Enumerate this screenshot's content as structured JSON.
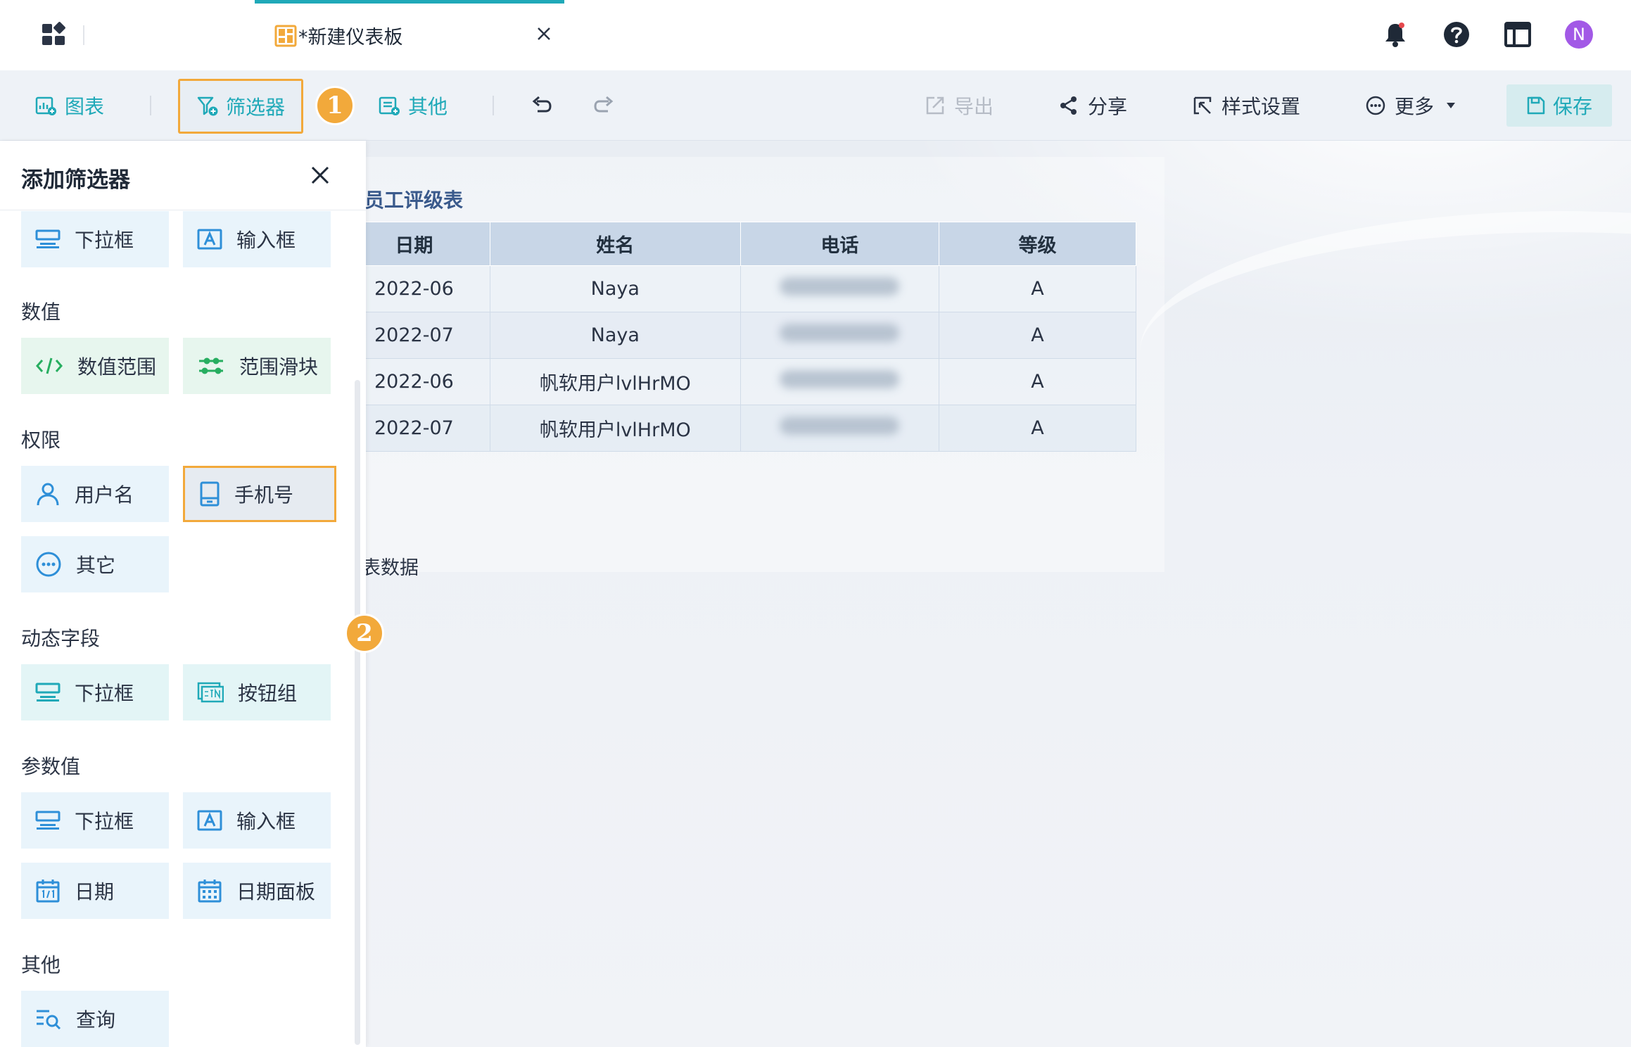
{
  "tab": {
    "title": "*新建仪表板"
  },
  "toolbar": {
    "chart_label": "图表",
    "filter_label": "筛选器",
    "other_label": "其他",
    "export_label": "导出",
    "share_label": "分享",
    "style_label": "样式设置",
    "more_label": "更多",
    "save_label": "保存"
  },
  "steps": {
    "one": "1",
    "two": "2"
  },
  "user": {
    "avatar_letter": "N"
  },
  "panel": {
    "title": "添加筛选器",
    "top_row": [
      "下拉框",
      "输入框"
    ],
    "sections": {
      "numeric": {
        "label": "数值",
        "items": [
          "数值范围",
          "范围滑块"
        ]
      },
      "permission": {
        "label": "权限",
        "items": [
          "用户名",
          "手机号",
          "其它"
        ]
      },
      "dynamic": {
        "label": "动态字段",
        "items": [
          "下拉框",
          "按钮组"
        ]
      },
      "param": {
        "label": "参数值",
        "items": [
          "下拉框",
          "输入框",
          "日期",
          "日期面板"
        ]
      },
      "other": {
        "label": "其他",
        "items": [
          "查询"
        ]
      }
    }
  },
  "widget": {
    "title": "员工评级表",
    "headers": [
      "日期",
      "姓名",
      "电话",
      "等级"
    ],
    "rows": [
      {
        "date": "2022-06",
        "name": "Naya",
        "grade": "A"
      },
      {
        "date": "2022-07",
        "name": "Naya",
        "grade": "A"
      },
      {
        "date": "2022-06",
        "name": "帆软用户lvlHrMO",
        "grade": "A"
      },
      {
        "date": "2022-07",
        "name": "帆软用户lvlHrMO",
        "grade": "A"
      }
    ],
    "note": "表数据"
  },
  "colors": {
    "accent": "#1fa9b8",
    "highlight": "#f2a93b",
    "avatar": "#a259e6"
  }
}
